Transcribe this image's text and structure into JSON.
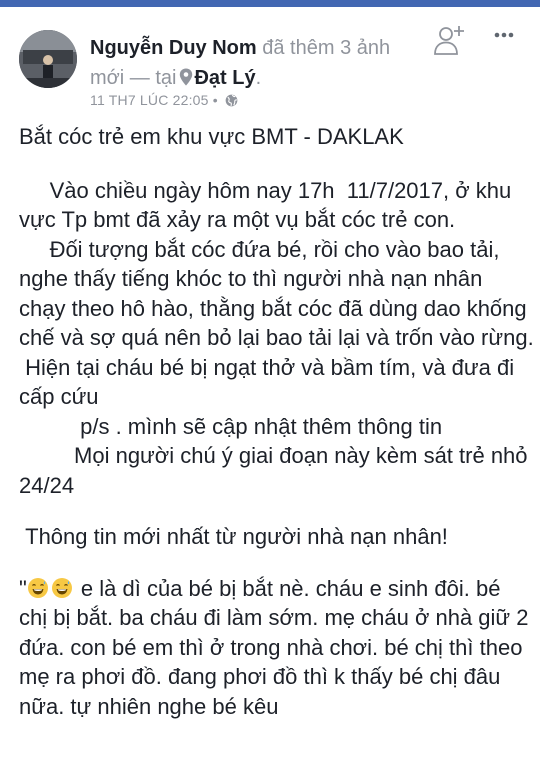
{
  "post": {
    "author": "Nguyễn Duy Nom",
    "action": "đã thêm 3 ảnh mới — tại",
    "location": "Đạt Lý",
    "location_suffix": ".",
    "timestamp": "11 TH7 LÚC 22:05",
    "separator": "•",
    "icons": {
      "add_friend": "add-friend-icon",
      "more": "more-options-icon",
      "pin": "location-pin-icon",
      "privacy": "globe-icon",
      "emoji": "grinning-sweat-emoji"
    },
    "body": {
      "title": "Bắt cóc trẻ em khu vực BMT - DAKLAK",
      "para1": "     Vào chiều ngày hôm nay 17h  11/7/2017, ở khu vực Tp bmt đã xảy ra một vụ bắt cóc trẻ con.",
      "para2": "     Đối tượng bắt cóc đứa bé, rồi cho vào bao tải, nghe thấy tiếng khóc to thì người nhà nạn nhân chạy theo hô hào, thằng bắt cóc đã dùng dao khống chế và sợ quá nên bỏ lại bao tải lại và trốn vào rừng.",
      "para3": " Hiện tại cháu bé bị ngạt thở và bầm tím, và đưa đi cấp cứu",
      "para4": "          p/s . mình sẽ cập nhật thêm thông tin",
      "para5": "         Mọi người chú ý giai đoạn này kèm sát trẻ nhỏ 24/24",
      "update_heading": " Thông tin mới nhất từ người nhà nạn nhân!",
      "quote_open": "\"",
      "quote_text": " e là dì của bé bị bắt nè. cháu e sinh đôi. bé chị bị bắt. ba cháu đi làm sớm. mẹ cháu ở nhà giữ 2 đứa. con bé em thì ở trong nhà chơi. bé chị thì theo mẹ ra phơi đồ. đang phơi đồ thì k thấy bé chị đâu nữa. tự nhiên nghe bé kêu"
    }
  }
}
